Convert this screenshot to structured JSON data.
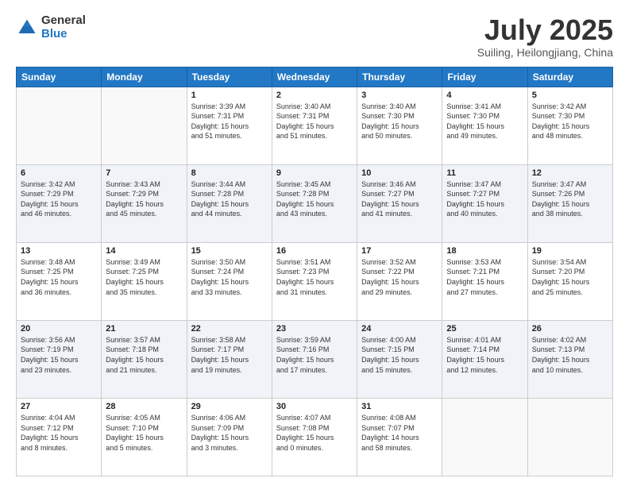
{
  "header": {
    "logo_general": "General",
    "logo_blue": "Blue",
    "month": "July 2025",
    "location": "Suiling, Heilongjiang, China"
  },
  "weekdays": [
    "Sunday",
    "Monday",
    "Tuesday",
    "Wednesday",
    "Thursday",
    "Friday",
    "Saturday"
  ],
  "weeks": [
    [
      {
        "day": "",
        "info": ""
      },
      {
        "day": "",
        "info": ""
      },
      {
        "day": "1",
        "info": "Sunrise: 3:39 AM\nSunset: 7:31 PM\nDaylight: 15 hours\nand 51 minutes."
      },
      {
        "day": "2",
        "info": "Sunrise: 3:40 AM\nSunset: 7:31 PM\nDaylight: 15 hours\nand 51 minutes."
      },
      {
        "day": "3",
        "info": "Sunrise: 3:40 AM\nSunset: 7:30 PM\nDaylight: 15 hours\nand 50 minutes."
      },
      {
        "day": "4",
        "info": "Sunrise: 3:41 AM\nSunset: 7:30 PM\nDaylight: 15 hours\nand 49 minutes."
      },
      {
        "day": "5",
        "info": "Sunrise: 3:42 AM\nSunset: 7:30 PM\nDaylight: 15 hours\nand 48 minutes."
      }
    ],
    [
      {
        "day": "6",
        "info": "Sunrise: 3:42 AM\nSunset: 7:29 PM\nDaylight: 15 hours\nand 46 minutes."
      },
      {
        "day": "7",
        "info": "Sunrise: 3:43 AM\nSunset: 7:29 PM\nDaylight: 15 hours\nand 45 minutes."
      },
      {
        "day": "8",
        "info": "Sunrise: 3:44 AM\nSunset: 7:28 PM\nDaylight: 15 hours\nand 44 minutes."
      },
      {
        "day": "9",
        "info": "Sunrise: 3:45 AM\nSunset: 7:28 PM\nDaylight: 15 hours\nand 43 minutes."
      },
      {
        "day": "10",
        "info": "Sunrise: 3:46 AM\nSunset: 7:27 PM\nDaylight: 15 hours\nand 41 minutes."
      },
      {
        "day": "11",
        "info": "Sunrise: 3:47 AM\nSunset: 7:27 PM\nDaylight: 15 hours\nand 40 minutes."
      },
      {
        "day": "12",
        "info": "Sunrise: 3:47 AM\nSunset: 7:26 PM\nDaylight: 15 hours\nand 38 minutes."
      }
    ],
    [
      {
        "day": "13",
        "info": "Sunrise: 3:48 AM\nSunset: 7:25 PM\nDaylight: 15 hours\nand 36 minutes."
      },
      {
        "day": "14",
        "info": "Sunrise: 3:49 AM\nSunset: 7:25 PM\nDaylight: 15 hours\nand 35 minutes."
      },
      {
        "day": "15",
        "info": "Sunrise: 3:50 AM\nSunset: 7:24 PM\nDaylight: 15 hours\nand 33 minutes."
      },
      {
        "day": "16",
        "info": "Sunrise: 3:51 AM\nSunset: 7:23 PM\nDaylight: 15 hours\nand 31 minutes."
      },
      {
        "day": "17",
        "info": "Sunrise: 3:52 AM\nSunset: 7:22 PM\nDaylight: 15 hours\nand 29 minutes."
      },
      {
        "day": "18",
        "info": "Sunrise: 3:53 AM\nSunset: 7:21 PM\nDaylight: 15 hours\nand 27 minutes."
      },
      {
        "day": "19",
        "info": "Sunrise: 3:54 AM\nSunset: 7:20 PM\nDaylight: 15 hours\nand 25 minutes."
      }
    ],
    [
      {
        "day": "20",
        "info": "Sunrise: 3:56 AM\nSunset: 7:19 PM\nDaylight: 15 hours\nand 23 minutes."
      },
      {
        "day": "21",
        "info": "Sunrise: 3:57 AM\nSunset: 7:18 PM\nDaylight: 15 hours\nand 21 minutes."
      },
      {
        "day": "22",
        "info": "Sunrise: 3:58 AM\nSunset: 7:17 PM\nDaylight: 15 hours\nand 19 minutes."
      },
      {
        "day": "23",
        "info": "Sunrise: 3:59 AM\nSunset: 7:16 PM\nDaylight: 15 hours\nand 17 minutes."
      },
      {
        "day": "24",
        "info": "Sunrise: 4:00 AM\nSunset: 7:15 PM\nDaylight: 15 hours\nand 15 minutes."
      },
      {
        "day": "25",
        "info": "Sunrise: 4:01 AM\nSunset: 7:14 PM\nDaylight: 15 hours\nand 12 minutes."
      },
      {
        "day": "26",
        "info": "Sunrise: 4:02 AM\nSunset: 7:13 PM\nDaylight: 15 hours\nand 10 minutes."
      }
    ],
    [
      {
        "day": "27",
        "info": "Sunrise: 4:04 AM\nSunset: 7:12 PM\nDaylight: 15 hours\nand 8 minutes."
      },
      {
        "day": "28",
        "info": "Sunrise: 4:05 AM\nSunset: 7:10 PM\nDaylight: 15 hours\nand 5 minutes."
      },
      {
        "day": "29",
        "info": "Sunrise: 4:06 AM\nSunset: 7:09 PM\nDaylight: 15 hours\nand 3 minutes."
      },
      {
        "day": "30",
        "info": "Sunrise: 4:07 AM\nSunset: 7:08 PM\nDaylight: 15 hours\nand 0 minutes."
      },
      {
        "day": "31",
        "info": "Sunrise: 4:08 AM\nSunset: 7:07 PM\nDaylight: 14 hours\nand 58 minutes."
      },
      {
        "day": "",
        "info": ""
      },
      {
        "day": "",
        "info": ""
      }
    ]
  ]
}
